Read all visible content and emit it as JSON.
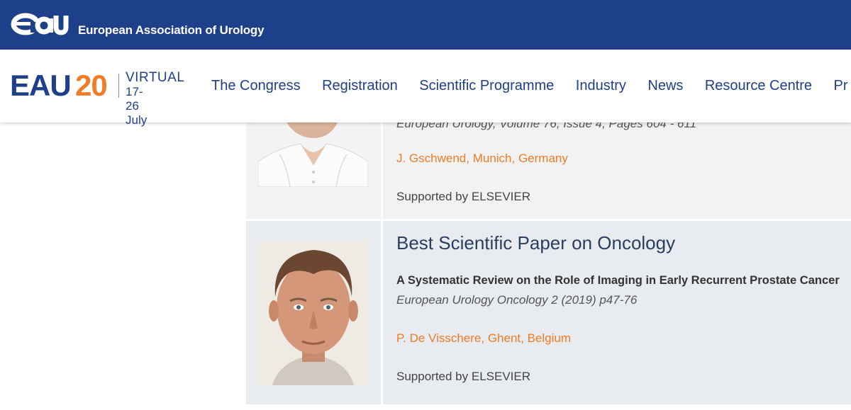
{
  "header": {
    "logo_text": "eau",
    "association_name": "European Association of Urology"
  },
  "brand": {
    "name_part1": "EAU",
    "name_part2": "20",
    "virtual_label": "VIRTUAL",
    "dates": "17-26 July"
  },
  "nav": {
    "items": [
      "The Congress",
      "Registration",
      "Scientific Programme",
      "Industry",
      "News",
      "Resource Centre",
      "Pr"
    ]
  },
  "awards": [
    {
      "journal_partial": "European Urology, Volume 76, Issue 4, Pages 604 - 611",
      "author": "J. Gschwend, Munich, Germany",
      "supported_by": "Supported by ELSEVIER"
    },
    {
      "award_title": "Best Scientific Paper on Oncology",
      "paper_title": "A Systematic Review on the Role of Imaging in Early Recurrent Prostate Cancer",
      "journal": "European Urology Oncology 2 (2019) p47-76",
      "author": "P. De Visschere, Ghent, Belgium",
      "supported_by": "Supported by ELSEVIER"
    }
  ],
  "colors": {
    "brand_blue": "#1e3f8a",
    "brand_orange": "#f07c24"
  }
}
